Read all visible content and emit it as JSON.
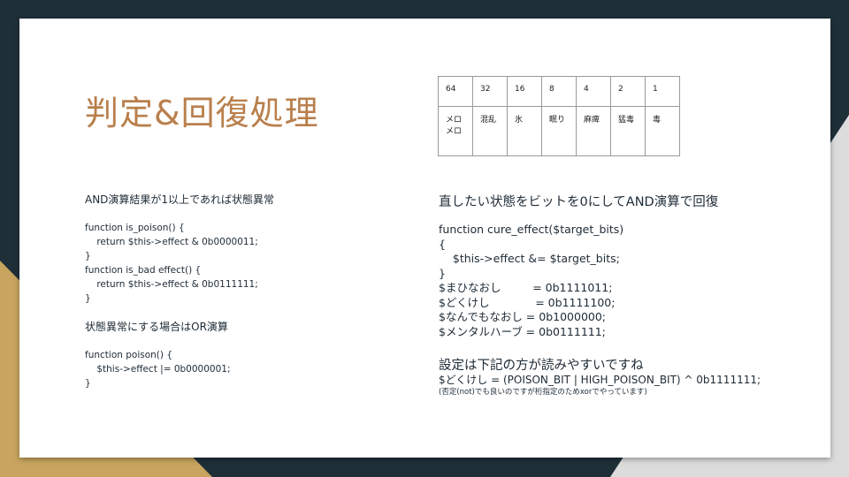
{
  "slide": {
    "title": "判定&回復処理",
    "bit_table": {
      "values": [
        "64",
        "32",
        "16",
        "8",
        "4",
        "2",
        "1"
      ],
      "names": [
        "メロ\nメロ",
        "混乱",
        "氷",
        "眠り",
        "麻痺",
        "猛毒",
        "毒"
      ]
    },
    "left": {
      "heading1": "AND演算結果が1以上であれば状態異常",
      "code1": "function is_poison() {\n    return $this->effect & 0b0000011;\n}\nfunction is_bad effect() {\n    return $this->effect & 0b0111111;\n}",
      "heading2": "状態異常にする場合はOR演算",
      "code2": "function poison() {\n    $this->effect |= 0b0000001;\n}"
    },
    "right": {
      "heading1": "直したい状態をビットを0にしてAND演算で回復",
      "code1": "function cure_effect($target_bits)\n{\n    $this->effect &= $target_bits;\n}\n$まひなおし         = 0b1111011;\n$どくけし             = 0b1111100;\n$なんでもなおし = 0b1000000;\n$メンタルハーブ = 0b0111111;",
      "heading2": "設定は下記の方が読みやすいですね",
      "code2": "$どくけし = (POISON_BIT | HIGH_POISON_BIT) ^ 0b1111111;",
      "note": "(否定(not)でも良いのですが桁指定のためxorでやっています)"
    }
  },
  "colors": {
    "background_dark": "#1f2f38",
    "accent_gold": "#c8a45e",
    "title": "#b97f4c",
    "text": "#1e2b36"
  }
}
